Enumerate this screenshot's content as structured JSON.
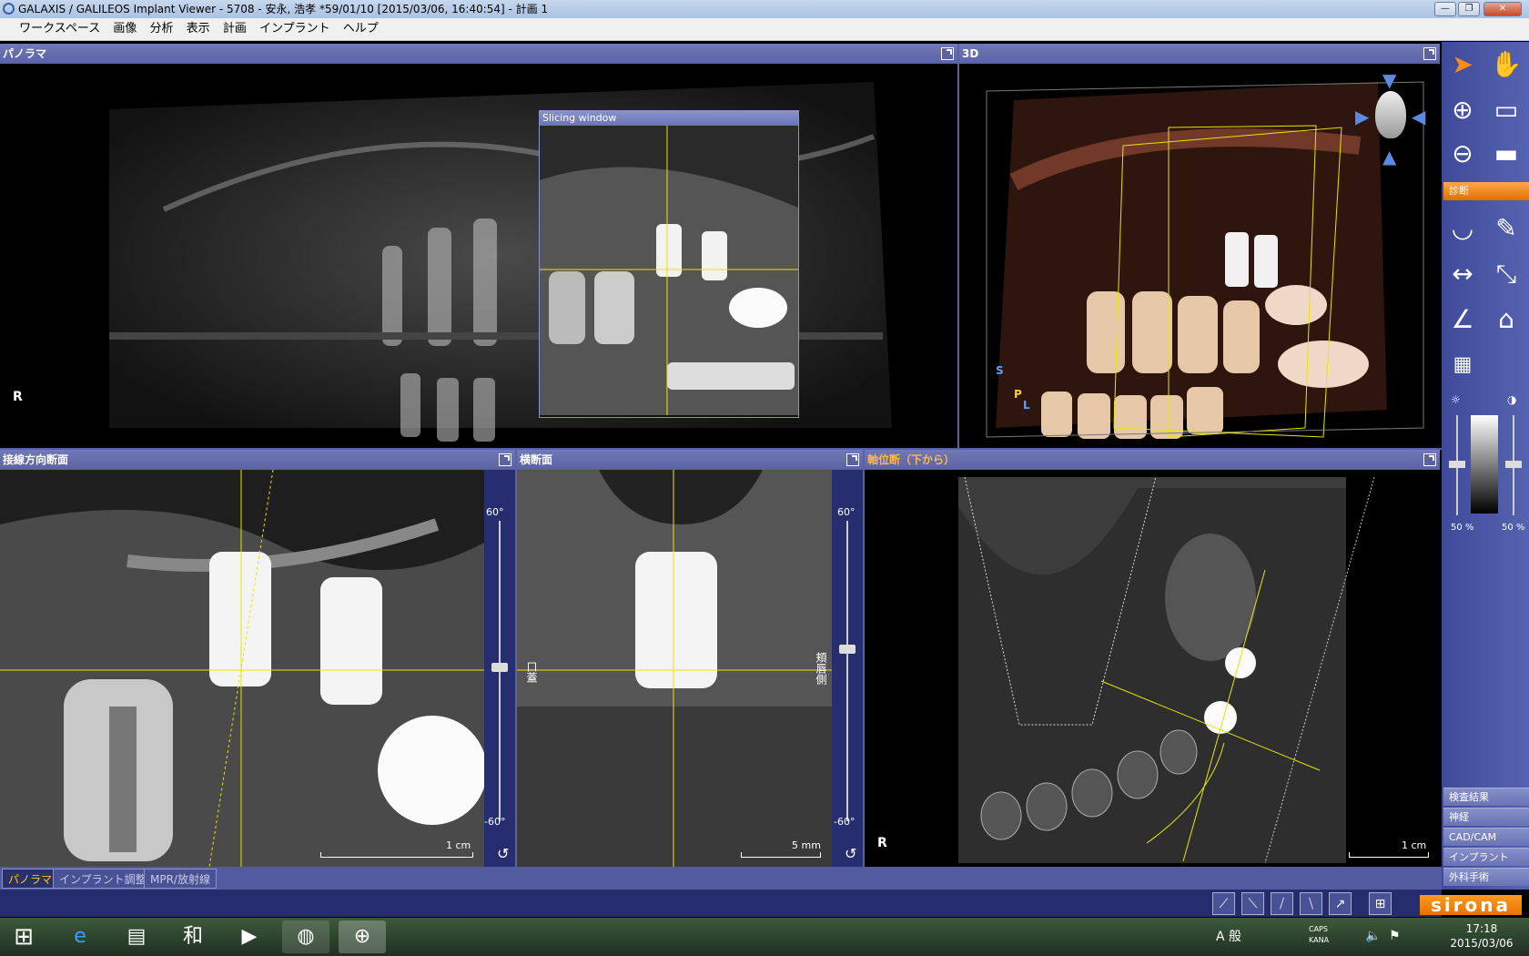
{
  "window": {
    "title": "GALAXIS / GALILEOS Implant Viewer - 5708 - 安永, 浩孝 *59/01/10 [2015/03/06, 16:40:54] - 計画 1",
    "minimize": "—",
    "restore": "❐",
    "close": "✕"
  },
  "menu": [
    "ワークスペース",
    "画像",
    "分析",
    "表示",
    "計画",
    "インプラント",
    "ヘルプ"
  ],
  "panels": {
    "panorama": {
      "title": "パノラマ",
      "orientation": "R"
    },
    "slicing_window": {
      "title": "Slicing window"
    },
    "view3d": {
      "title": "3D",
      "axis_s": "S",
      "axis_p": "P",
      "axis_l": "L"
    },
    "tangential": {
      "title": "接線方向断面",
      "scale": "1 cm",
      "slider_top": "60°",
      "slider_bottom": "-60°"
    },
    "cross": {
      "title": "横断面",
      "scale": "5 mm",
      "slider_top": "60°",
      "slider_bottom": "-60°",
      "left_label": "口蓋",
      "right_label": "頬唇側"
    },
    "axial": {
      "title": "軸位断（下から）",
      "scale": "1 cm",
      "orientation": "R"
    }
  },
  "right_panel": {
    "section_label": "診断",
    "brightness_value": "50 %",
    "contrast_value": "50 %",
    "buttons": [
      "検査結果",
      "神経",
      "CAD/CAM",
      "インプラント",
      "外科手術"
    ]
  },
  "tabs": [
    "パノラマ",
    "インプラント調整",
    "MPR/放射線"
  ],
  "brand": "sirona",
  "taskbar": {
    "time": "17:18",
    "date": "2015/03/06",
    "ime": "A 般",
    "caps": "CAPS",
    "kana": "KANA"
  }
}
